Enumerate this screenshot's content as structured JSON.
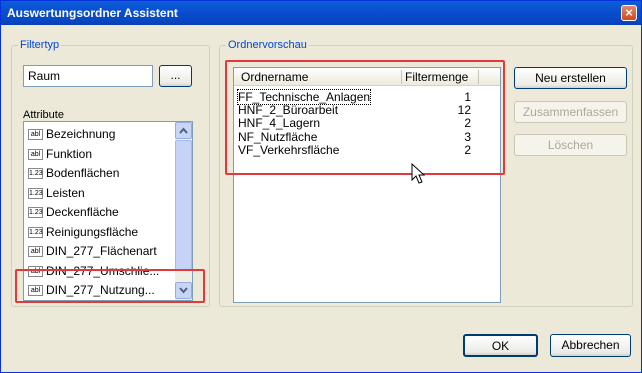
{
  "window": {
    "title": "Auswertungsordner Assistent"
  },
  "filter": {
    "group_label": "Filtertyp",
    "type_value": "Raum",
    "browse_label": "...",
    "attributes_label": "Attribute",
    "attributes": [
      {
        "type": "abl",
        "label": "Bezeichnung"
      },
      {
        "type": "abl",
        "label": "Funktion"
      },
      {
        "type": "1.23",
        "label": "Bodenflächen"
      },
      {
        "type": "1.23",
        "label": "Leisten"
      },
      {
        "type": "1.23",
        "label": "Deckenfläche"
      },
      {
        "type": "1.23",
        "label": "Reinigungsfläche"
      },
      {
        "type": "abl",
        "label": "DIN_277_Flächenart"
      },
      {
        "type": "abl",
        "label": "DIN_277_Umschlie..."
      },
      {
        "type": "abl",
        "label": "DIN_277_Nutzung..."
      }
    ]
  },
  "preview": {
    "group_label": "Ordnervorschau",
    "col_name": "Ordnername",
    "col_count": "Filtermenge",
    "rows": [
      {
        "name": "FF_Technische_Anlagen",
        "count": "1"
      },
      {
        "name": "HNF_2_Büroarbeit",
        "count": "12"
      },
      {
        "name": "HNF_4_Lagern",
        "count": "2"
      },
      {
        "name": "NF_Nutzfläche",
        "count": "3"
      },
      {
        "name": "VF_Verkehrsfläche",
        "count": "2"
      }
    ]
  },
  "actions": {
    "new_label": "Neu erstellen",
    "merge_label": "Zusammenfassen",
    "delete_label": "Löschen"
  },
  "footer": {
    "ok_label": "OK",
    "cancel_label": "Abbrechen"
  },
  "colors": {
    "highlight": "#e23a3a",
    "title_bar": "#0a5fd8",
    "group_label": "#0046d5"
  }
}
